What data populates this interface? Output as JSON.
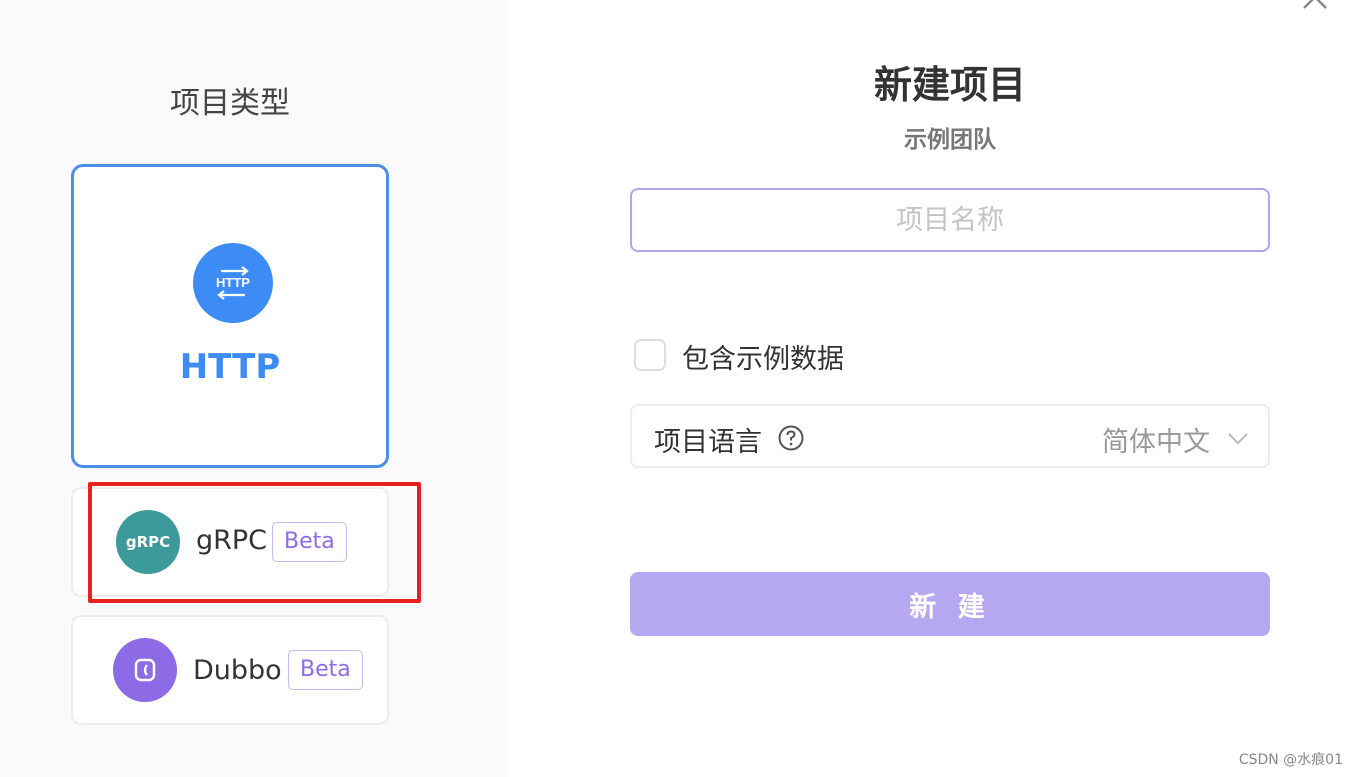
{
  "left_panel": {
    "title": "项目类型",
    "types": {
      "http": {
        "label": "HTTP",
        "icon": "http-icon",
        "icon_text": "HTTP",
        "color": "#3d8bf5",
        "selected": true
      },
      "grpc": {
        "label": "gRPC",
        "icon": "grpc-icon",
        "icon_text": "gRPC",
        "badge": "Beta",
        "color": "#3d9a9a"
      },
      "dubbo": {
        "label": "Dubbo",
        "icon": "dubbo-icon",
        "badge": "Beta",
        "color": "#8d6be6"
      }
    }
  },
  "form": {
    "title": "新建项目",
    "subtitle": "示例团队",
    "name_input": {
      "placeholder": "项目名称",
      "value": ""
    },
    "sample_data_checkbox": {
      "label": "包含示例数据",
      "checked": false
    },
    "language": {
      "label": "项目语言",
      "value": "简体中文",
      "help_icon": "question-circle-icon",
      "chevron": "chevron-down-icon"
    },
    "create_button": "新 建"
  },
  "watermark": "CSDN @水痕01",
  "colors": {
    "accent_blue": "#3d8bf5",
    "accent_purple": "#b6a8f0",
    "highlight_red": "#e6211f"
  }
}
